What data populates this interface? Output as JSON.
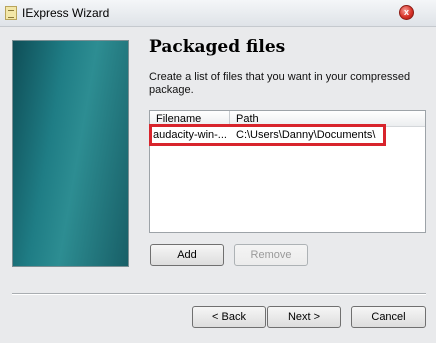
{
  "window": {
    "title": "IExpress Wizard",
    "close_symbol": "x"
  },
  "page": {
    "heading": "Packaged files",
    "description": "Create a list of files that you want in your compressed package."
  },
  "file_list": {
    "columns": [
      "Filename",
      "Path"
    ],
    "rows": [
      {
        "filename": "audacity-win-...",
        "path": "C:\\Users\\Danny\\Documents\\"
      }
    ]
  },
  "buttons": {
    "add": "Add",
    "remove": "Remove",
    "back": "< Back",
    "next": "Next >",
    "cancel": "Cancel"
  },
  "colors": {
    "highlight": "#d8242c",
    "panel": "#1f7d85"
  },
  "icons": {
    "app": "iexpress-icon",
    "close": "close-icon"
  }
}
